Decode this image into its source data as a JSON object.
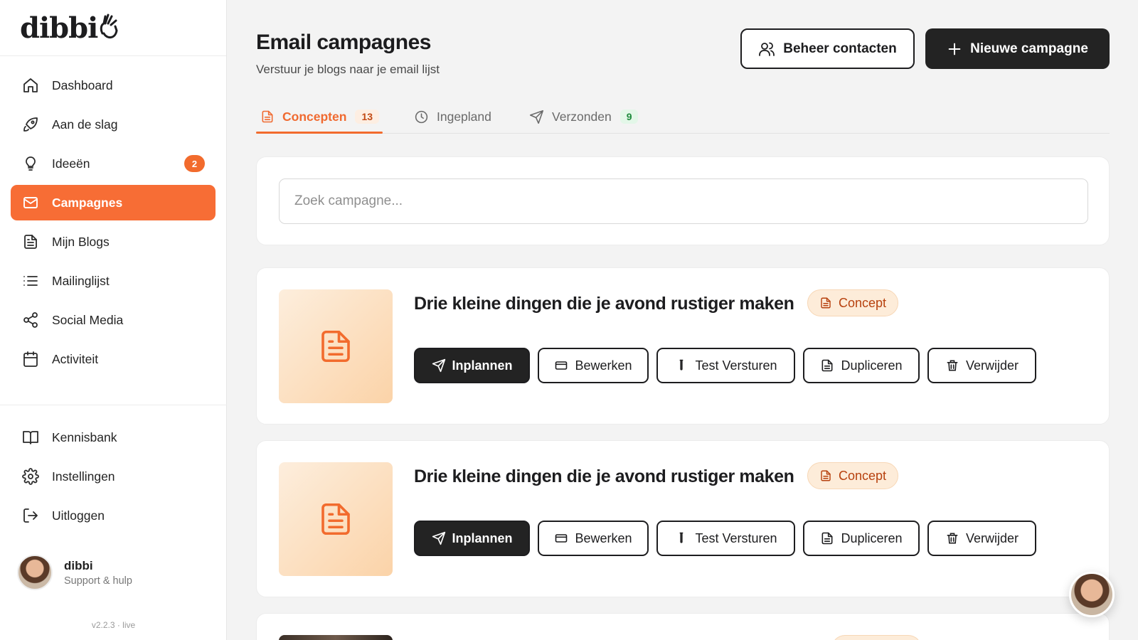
{
  "brand": {
    "logo_text": "dibbi"
  },
  "sidebar": {
    "items": [
      {
        "label": "Dashboard",
        "icon": "home-icon"
      },
      {
        "label": "Aan de slag",
        "icon": "rocket-icon"
      },
      {
        "label": "Ideeën",
        "icon": "lightbulb-icon",
        "badge": "2"
      },
      {
        "label": "Campagnes",
        "icon": "mail-icon",
        "active": true
      },
      {
        "label": "Mijn Blogs",
        "icon": "document-icon"
      },
      {
        "label": "Mailinglijst",
        "icon": "list-icon"
      },
      {
        "label": "Social Media",
        "icon": "share-icon"
      },
      {
        "label": "Activiteit",
        "icon": "calendar-icon"
      }
    ],
    "bottom_items": [
      {
        "label": "Kennisbank",
        "icon": "book-icon"
      },
      {
        "label": "Instellingen",
        "icon": "gear-icon"
      },
      {
        "label": "Uitloggen",
        "icon": "logout-icon"
      }
    ],
    "user": {
      "name": "dibbi",
      "subtitle": "Support & hulp"
    },
    "version": "v2.2.3 · live"
  },
  "header": {
    "title": "Email campagnes",
    "subtitle": "Verstuur je blogs naar je email lijst",
    "manage_contacts_label": "Beheer contacten",
    "new_campaign_label": "Nieuwe campagne"
  },
  "tabs": [
    {
      "label": "Concepten",
      "count": "13",
      "active": true
    },
    {
      "label": "Ingepland"
    },
    {
      "label": "Verzonden",
      "count": "9"
    }
  ],
  "search": {
    "placeholder": "Zoek campagne..."
  },
  "campaigns": [
    {
      "title": "Drie kleine dingen die je avond rustiger maken",
      "status": "Concept",
      "actions": [
        "Inplannen",
        "Bewerken",
        "Test Versturen",
        "Dupliceren",
        "Verwijder"
      ]
    },
    {
      "title": "Drie kleine dingen die je avond rustiger maken",
      "status": "Concept",
      "actions": [
        "Inplannen",
        "Bewerken",
        "Test Versturen",
        "Dupliceren",
        "Verwijder"
      ]
    }
  ],
  "colors": {
    "accent": "#f76d35",
    "dark": "#232323",
    "badge_bg": "#fdecd9",
    "badge_text": "#b7410e",
    "count_green_text": "#1e8a3c"
  }
}
